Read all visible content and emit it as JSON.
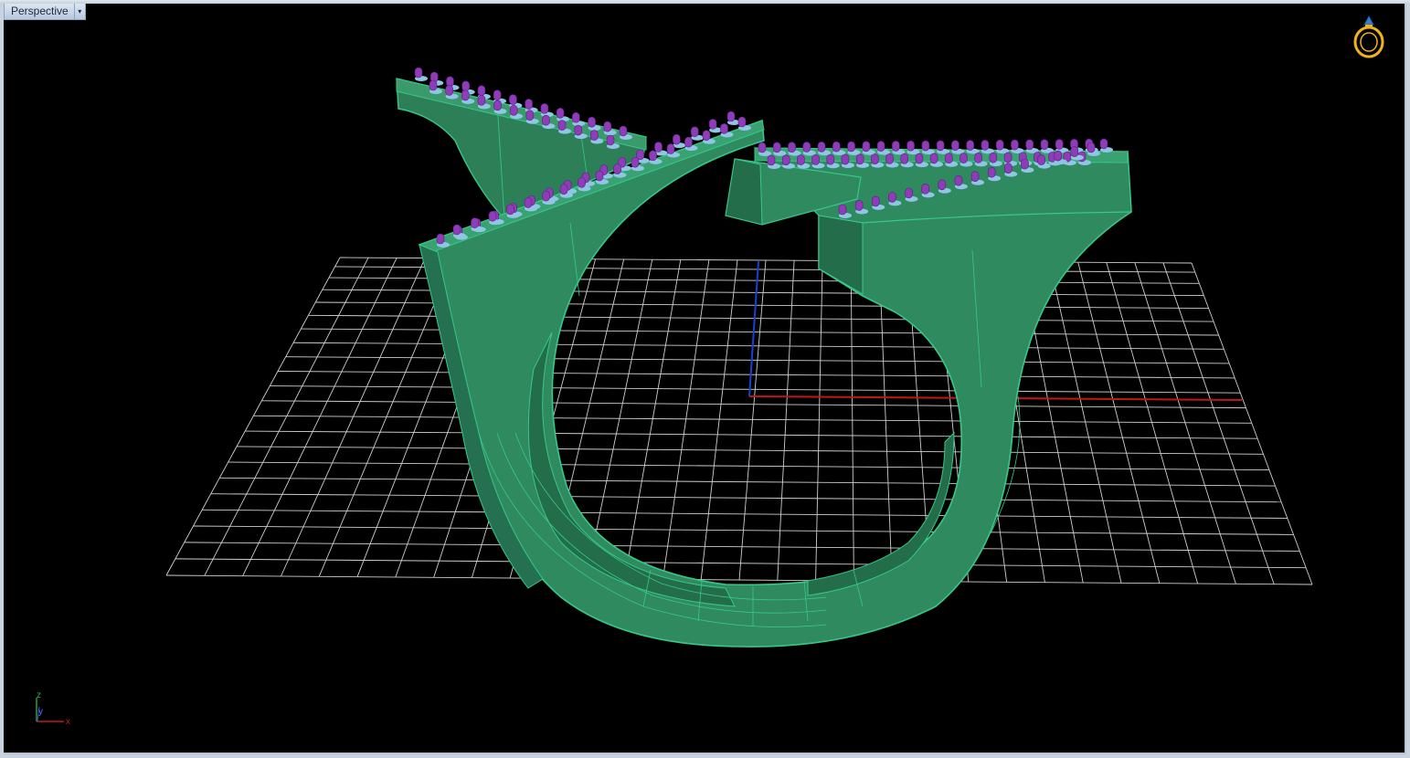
{
  "viewport": {
    "title": "Perspective",
    "menu_arrow": "▾"
  },
  "axis_widget": {
    "z_label": "z",
    "y_label": "y",
    "x_label": "x"
  },
  "icons": {
    "ring_icon": "ring-icon"
  },
  "colors": {
    "background": "#000000",
    "grid": "#cfcfcf",
    "ring_fill": "#2f8a5f",
    "ring_edges": "#36c989",
    "gems": "#8e3cb8",
    "settings": "#8fc6e6",
    "x_axis": "#c01818",
    "z_axis": "#1f3fd0"
  }
}
